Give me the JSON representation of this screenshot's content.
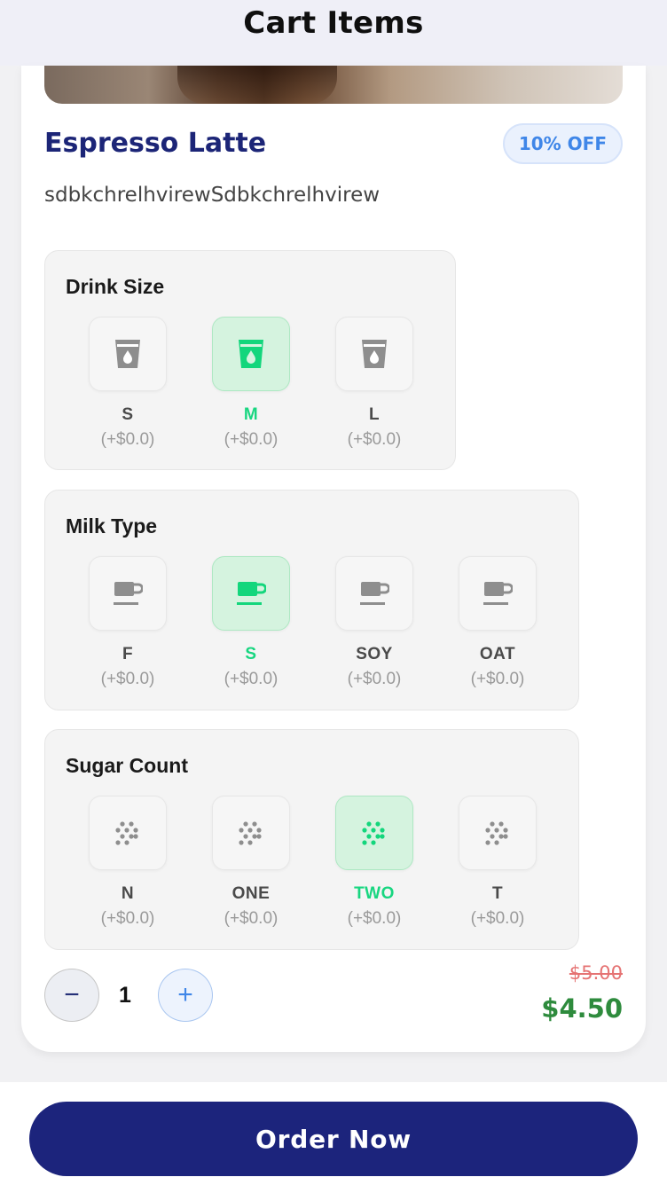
{
  "header": {
    "title": "Cart Items"
  },
  "product": {
    "name": "Espresso Latte",
    "discount_badge": "10% OFF",
    "description": "sdbkchrelhvirewSdbkchrelhvirew"
  },
  "options": {
    "drink_size": {
      "title": "Drink Size",
      "icon": "cup-icon",
      "items": [
        {
          "label": "S",
          "price": "(+$0.0)"
        },
        {
          "label": "M",
          "price": "(+$0.0)",
          "selected": true
        },
        {
          "label": "L",
          "price": "(+$0.0)"
        }
      ]
    },
    "milk_type": {
      "title": "Milk Type",
      "icon": "coffee-mug-icon",
      "items": [
        {
          "label": "F",
          "price": "(+$0.0)"
        },
        {
          "label": "S",
          "price": "(+$0.0)",
          "selected": true
        },
        {
          "label": "SOY",
          "price": "(+$0.0)"
        },
        {
          "label": "OAT",
          "price": "(+$0.0)"
        }
      ]
    },
    "sugar_count": {
      "title": "Sugar Count",
      "icon": "sugar-dots-icon",
      "items": [
        {
          "label": "N",
          "price": "(+$0.0)"
        },
        {
          "label": "ONE",
          "price": "(+$0.0)"
        },
        {
          "label": "TWO",
          "price": "(+$0.0)",
          "selected": true
        },
        {
          "label": "T",
          "price": "(+$0.0)"
        }
      ]
    }
  },
  "quantity": {
    "value": "1",
    "minus_label": "−",
    "plus_label": "+"
  },
  "price": {
    "original": "$5.00",
    "discounted": "$4.50"
  },
  "order_button": {
    "label": "Order Now"
  },
  "colors": {
    "brand_navy": "#1c247c",
    "selected_green": "#13d67c",
    "accent_blue": "#3f86e8",
    "price_green": "#2e8b3d",
    "strike_red": "#e57373"
  }
}
